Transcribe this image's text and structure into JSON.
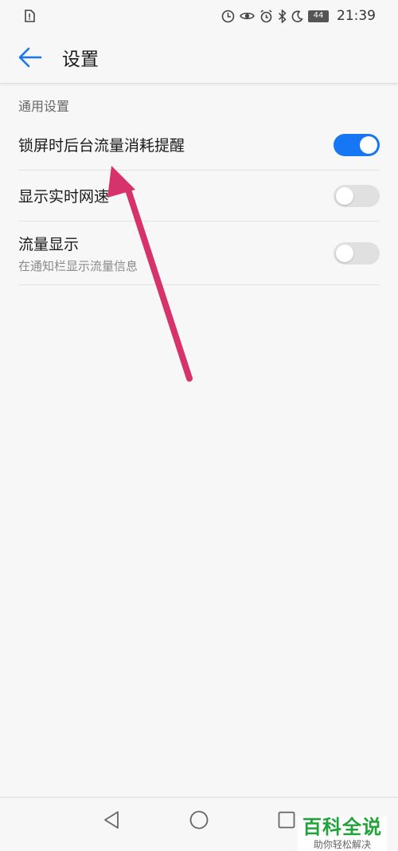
{
  "status_bar": {
    "time": "21:39",
    "battery": "44",
    "icons": [
      "sim-alert-icon",
      "data-saver-icon",
      "eye-icon",
      "alarm-icon",
      "bluetooth-icon",
      "moon-icon",
      "battery-icon"
    ]
  },
  "header": {
    "title": "设置",
    "back_icon": "arrow-left-icon"
  },
  "section": {
    "title": "通用设置"
  },
  "settings": [
    {
      "label": "锁屏时后台流量消耗提醒",
      "enabled": true
    },
    {
      "label": "显示实时网速",
      "enabled": false
    },
    {
      "label": "流量显示",
      "sublabel": "在通知栏显示流量信息",
      "enabled": false
    }
  ],
  "colors": {
    "accent": "#1676f3",
    "annotation_arrow": "#d6336c",
    "watermark": "#21a33a"
  },
  "navigation_bar": {
    "icons": [
      "nav-back-icon",
      "nav-home-icon",
      "nav-recent-icon"
    ]
  },
  "watermark": {
    "title": "百科全说",
    "subtitle": "助你轻松解决"
  }
}
